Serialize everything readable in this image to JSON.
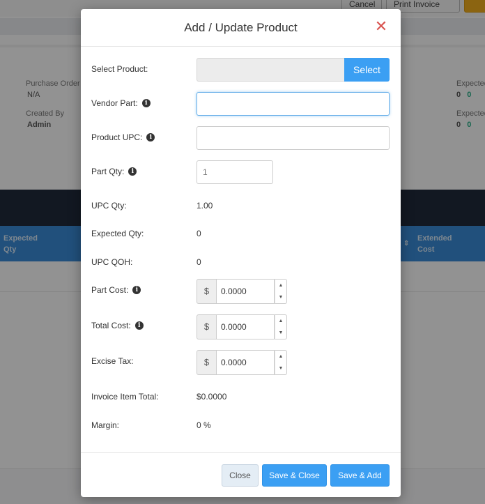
{
  "background": {
    "top_buttons": {
      "cancel": "Cancel",
      "print": "Print Invoice"
    },
    "purchase_order_label": "Purchase Order",
    "purchase_order_value": "N/A",
    "created_by_label": "Created By",
    "created_by_value": "Admin",
    "expected_label_1": "Expected",
    "expected_values_1": [
      "0",
      "0"
    ],
    "expected_label_2": "Expected",
    "expected_values_2": [
      "0",
      "0"
    ],
    "table_headers": {
      "expected_qty": [
        "Expected",
        "Qty"
      ],
      "extended_cost": [
        "Extended",
        "Cost"
      ],
      "sort_icon": "⇕"
    }
  },
  "modal": {
    "title": "Add / Update Product",
    "close_glyph": "✕",
    "select_product": {
      "label": "Select Product:",
      "button": "Select"
    },
    "vendor_part": {
      "label": "Vendor Part:",
      "value": ""
    },
    "product_upc": {
      "label": "Product UPC:",
      "value": ""
    },
    "part_qty": {
      "label": "Part Qty:",
      "placeholder": "1"
    },
    "upc_qty": {
      "label": "UPC Qty:",
      "value": "1.00"
    },
    "expected_qty": {
      "label": "Expected Qty:",
      "value": "0"
    },
    "upc_qoh": {
      "label": "UPC QOH:",
      "value": "0"
    },
    "part_cost": {
      "label": "Part Cost:",
      "currency": "$",
      "value": "0.0000"
    },
    "total_cost": {
      "label": "Total Cost:",
      "currency": "$",
      "value": "0.0000"
    },
    "excise_tax": {
      "label": "Excise Tax:",
      "currency": "$",
      "value": "0.0000"
    },
    "invoice_item_total": {
      "label": "Invoice Item Total:",
      "value": "$0.0000"
    },
    "margin": {
      "label": "Margin:",
      "value": "0 %"
    },
    "info_glyph": "i",
    "spin_up": "▲",
    "spin_down": "▼",
    "footer": {
      "close": "Close",
      "save_close": "Save & Close",
      "save_add": "Save & Add"
    }
  }
}
